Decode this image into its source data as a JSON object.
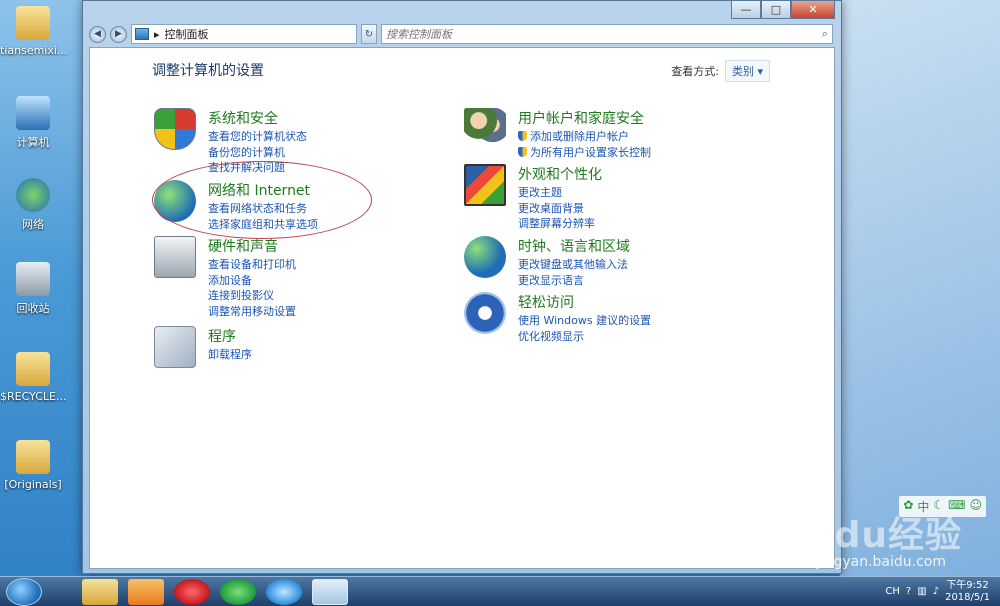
{
  "desktop": {
    "icons": [
      {
        "label": "tiansemixi..."
      },
      {
        "label": "计算机"
      },
      {
        "label": "网络"
      },
      {
        "label": "回收站"
      },
      {
        "label": "$RECYCLE..."
      },
      {
        "label": "[Originals]"
      }
    ]
  },
  "window": {
    "caption_buttons": {
      "minimize": "—",
      "maximize": "□",
      "close": "✕"
    },
    "address": {
      "breadcrumb": "控制面板",
      "separator": "▸"
    },
    "search": {
      "placeholder": "搜索控制面板"
    }
  },
  "main": {
    "title": "调整计算机的设置",
    "view_by_label": "查看方式:",
    "view_by_value": "类别 ▾",
    "categories": [
      {
        "title": "系统和安全",
        "icon": "shield-icon",
        "links": [
          "查看您的计算机状态",
          "备份您的计算机",
          "查找并解决问题"
        ]
      },
      {
        "title": "网络和 Internet",
        "icon": "network-globe-icon",
        "links": [
          "查看网络状态和任务",
          "选择家庭组和共享选项"
        ]
      },
      {
        "title": "硬件和声音",
        "icon": "printer-icon",
        "links": [
          "查看设备和打印机",
          "添加设备",
          "连接到投影仪",
          "调整常用移动设置"
        ]
      },
      {
        "title": "程序",
        "icon": "programs-icon",
        "links": [
          "卸载程序"
        ]
      },
      {
        "title": "用户帐户和家庭安全",
        "icon": "users-icon",
        "links": [
          "添加或删除用户帐户",
          "为所有用户设置家长控制"
        ]
      },
      {
        "title": "外观和个性化",
        "icon": "monitor-icon",
        "links": [
          "更改主题",
          "更改桌面背景",
          "调整屏幕分辨率"
        ]
      },
      {
        "title": "时钟、语言和区域",
        "icon": "clock-globe-icon",
        "links": [
          "更改键盘或其他输入法",
          "更改显示语言"
        ]
      },
      {
        "title": "轻松访问",
        "icon": "accessibility-icon",
        "links": [
          "使用 Windows 建议的设置",
          "优化视频显示"
        ]
      }
    ]
  },
  "taskbar": {
    "tray": {
      "lang": "CH",
      "time": "下午9:52",
      "date": "2018/5/1"
    }
  },
  "watermark": {
    "brand": "Baidu经验",
    "url": "jingyan.baidu.com"
  },
  "colors": {
    "category_title": "#1d7a1d",
    "link": "#1b56b3",
    "title": "#1b3a6b",
    "annotation": "#c2424a"
  }
}
